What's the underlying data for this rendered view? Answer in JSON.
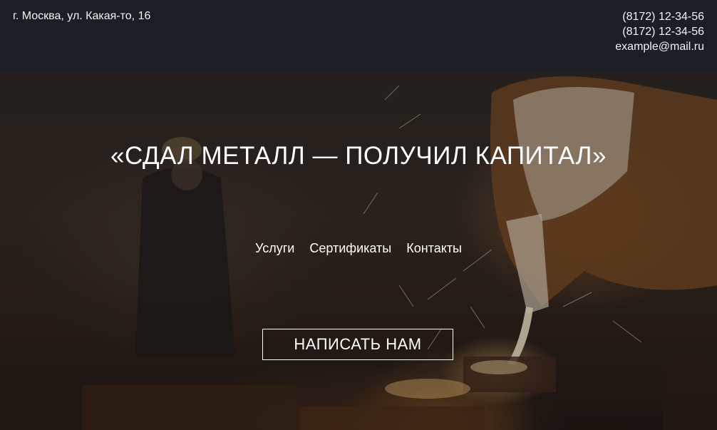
{
  "header": {
    "address": "г. Москва, ул. Какая-то, 16",
    "phone_1": "(8172) 12-34-56",
    "phone_2": "(8172) 12-34-56",
    "email": "example@mail.ru"
  },
  "hero": {
    "headline": "«СДАЛ МЕТАЛЛ — ПОЛУЧИЛ КАПИТАЛ»",
    "nav": [
      {
        "label": "Услуги"
      },
      {
        "label": "Сертификаты"
      },
      {
        "label": "Контакты"
      }
    ],
    "cta_label": "НАПИСАТЬ НАМ"
  },
  "colors": {
    "topbar_background": "#1b1f25",
    "text": "#ffffff"
  }
}
